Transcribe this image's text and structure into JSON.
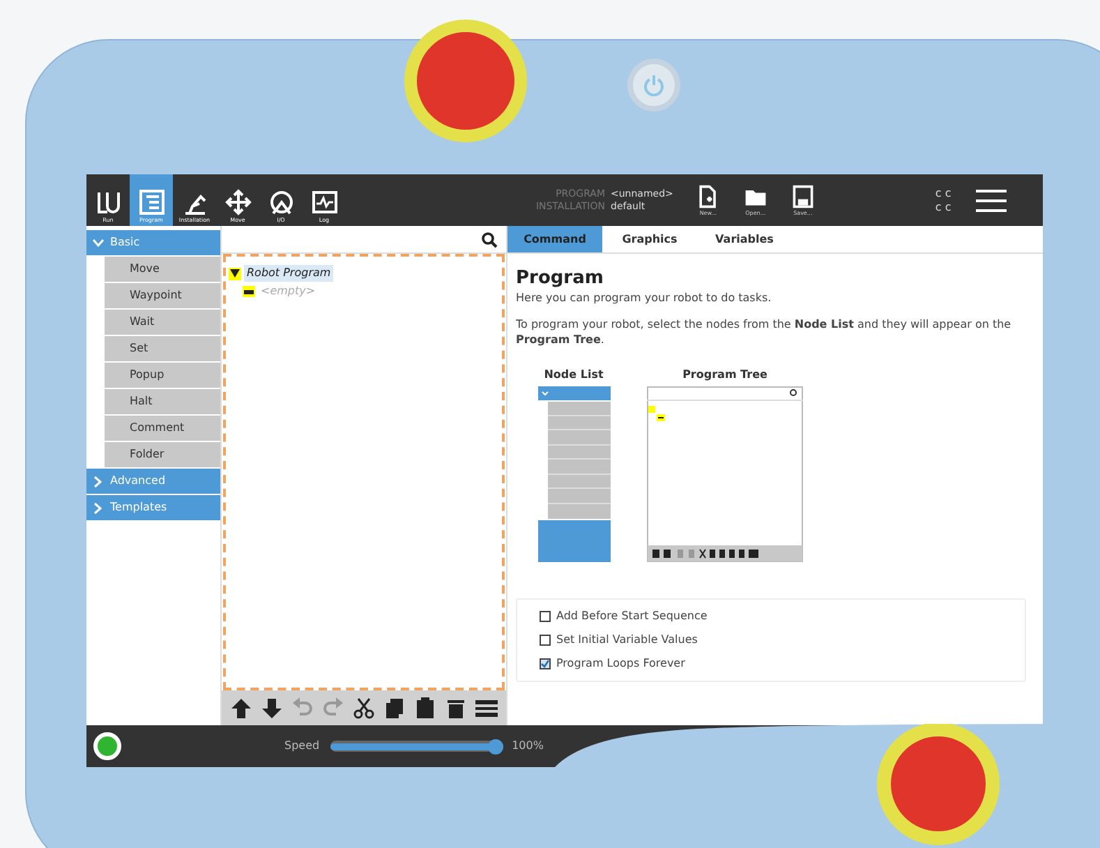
{
  "header": {
    "nav": [
      {
        "label": "Run",
        "kind": "run",
        "selected": false
      },
      {
        "label": "Program",
        "kind": "program",
        "selected": true
      },
      {
        "label": "Installation",
        "kind": "installation",
        "selected": false
      },
      {
        "label": "Move",
        "kind": "move",
        "selected": false
      },
      {
        "label": "I/O",
        "kind": "io",
        "selected": false
      },
      {
        "label": "Log",
        "kind": "log",
        "selected": false
      }
    ],
    "program_label": "PROGRAM",
    "program_value": "<unnamed>",
    "installation_label": "INSTALLATION",
    "installation_value": "default",
    "file_buttons": [
      {
        "label": "New...",
        "kind": "new"
      },
      {
        "label": "Open...",
        "kind": "open"
      },
      {
        "label": "Save...",
        "kind": "save"
      }
    ],
    "mode_indicators": [
      "c c",
      "c c"
    ]
  },
  "node_list": {
    "groups": [
      {
        "label": "Basic",
        "expanded": true,
        "items": [
          "Move",
          "Waypoint",
          "Wait",
          "Set",
          "Popup",
          "Halt",
          "Comment",
          "Folder"
        ]
      },
      {
        "label": "Advanced",
        "expanded": false
      },
      {
        "label": "Templates",
        "expanded": false
      }
    ]
  },
  "program_tree": {
    "root": {
      "label": "Robot Program",
      "expanded": true,
      "children": [
        {
          "label": "<empty>"
        }
      ]
    },
    "toolbar": [
      {
        "kind": "up",
        "disabled": false
      },
      {
        "kind": "down",
        "disabled": false
      },
      {
        "kind": "undo",
        "disabled": true
      },
      {
        "kind": "redo",
        "disabled": true
      },
      {
        "kind": "cut",
        "disabled": false
      },
      {
        "kind": "copy",
        "disabled": false
      },
      {
        "kind": "paste",
        "disabled": false
      },
      {
        "kind": "delete",
        "disabled": false
      },
      {
        "kind": "suppress",
        "disabled": false
      }
    ]
  },
  "tabs": [
    {
      "label": "Command",
      "selected": true
    },
    {
      "label": "Graphics",
      "selected": false
    },
    {
      "label": "Variables",
      "selected": false
    }
  ],
  "command": {
    "title": "Program",
    "intro": "Here you can program your robot to do tasks.",
    "instructions": "To program your robot, select the nodes from the **Node List** and they will appear on the **Program Tree**.",
    "node_list_caption": "Node List",
    "program_tree_caption": "Program Tree",
    "options": [
      {
        "label": "Add Before Start Sequence",
        "checked": false
      },
      {
        "label": "Set Initial Variable Values",
        "checked": false
      },
      {
        "label": "Program Loops Forever",
        "checked": true
      }
    ]
  },
  "footer": {
    "speed_label": "Speed",
    "speed": {
      "level": 1
    },
    "speed_reading": "100%"
  }
}
